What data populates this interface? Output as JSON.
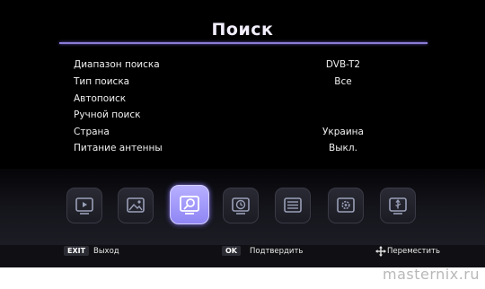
{
  "header": {
    "title": "Поиск"
  },
  "menu": {
    "items": [
      {
        "label": "Диапазон поиска",
        "value": "DVB-T2"
      },
      {
        "label": "Тип поиска",
        "value": "Все"
      },
      {
        "label": "Автопоиск",
        "value": ""
      },
      {
        "label": "Ручной поиск",
        "value": ""
      },
      {
        "label": "Страна",
        "value": "Украина"
      },
      {
        "label": "Питание антенны",
        "value": "Выкл."
      }
    ]
  },
  "icon_bar": {
    "selected_index": 2,
    "items": [
      "tv-icon",
      "picture-icon",
      "search-icon",
      "time-icon",
      "list-icon",
      "settings-icon",
      "usb-icon"
    ]
  },
  "footer": {
    "exit_key": "EXIT",
    "exit_label": "Выход",
    "ok_key": "OK",
    "ok_label": "Подтвердить",
    "move_label": "Переместить"
  },
  "watermark": {
    "text": "masternix.ru"
  },
  "colors": {
    "background": "#000000",
    "accent": "#8a7cd6",
    "active_tile": "#a59cff",
    "text": "#f0f0f0"
  }
}
